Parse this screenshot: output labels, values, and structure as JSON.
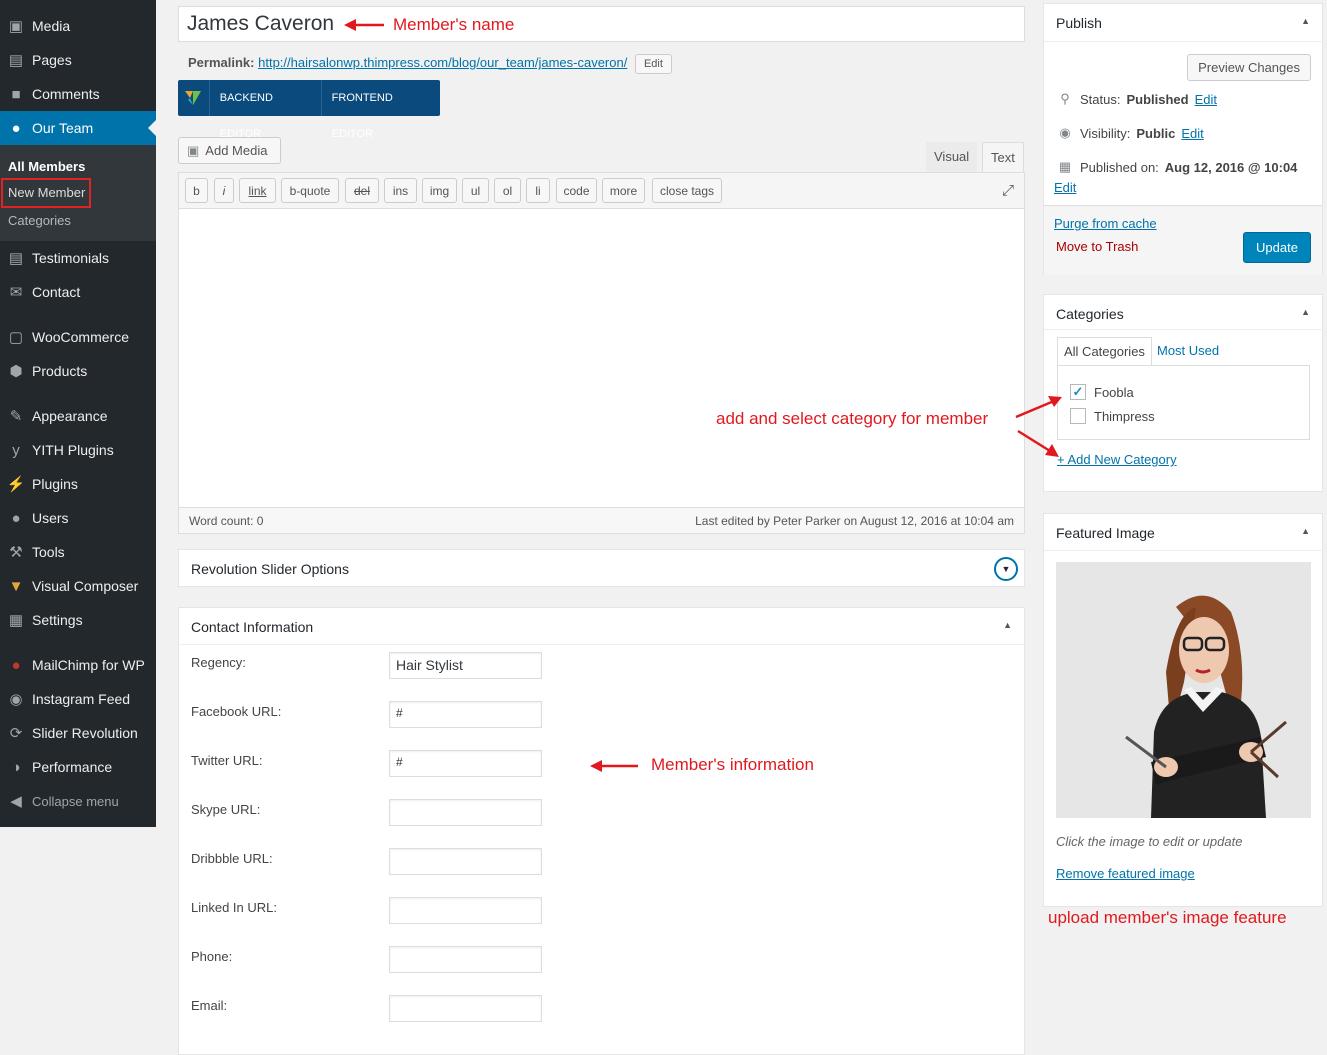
{
  "sidebar": {
    "items": [
      {
        "label": "Media",
        "icon": "media-icon"
      },
      {
        "label": "Pages",
        "icon": "pages-icon"
      },
      {
        "label": "Comments",
        "icon": "comments-icon"
      },
      {
        "label": "Our Team",
        "icon": "team-icon"
      },
      {
        "label": "Testimonials",
        "icon": "testimonials-icon"
      },
      {
        "label": "Contact",
        "icon": "contact-icon"
      },
      {
        "label": "WooCommerce",
        "icon": "woocommerce-icon"
      },
      {
        "label": "Products",
        "icon": "products-icon"
      },
      {
        "label": "Appearance",
        "icon": "appearance-icon"
      },
      {
        "label": "YITH Plugins",
        "icon": "yith-icon"
      },
      {
        "label": "Plugins",
        "icon": "plugins-icon"
      },
      {
        "label": "Users",
        "icon": "users-icon"
      },
      {
        "label": "Tools",
        "icon": "tools-icon"
      },
      {
        "label": "Visual Composer",
        "icon": "visual-composer-icon"
      },
      {
        "label": "Settings",
        "icon": "settings-icon"
      },
      {
        "label": "MailChimp for WP",
        "icon": "mailchimp-icon"
      },
      {
        "label": "Instagram Feed",
        "icon": "instagram-icon"
      },
      {
        "label": "Slider Revolution",
        "icon": "slider-revolution-icon"
      },
      {
        "label": "Performance",
        "icon": "performance-icon"
      }
    ],
    "submenu": [
      "All Members",
      "New Member",
      "Categories"
    ],
    "collapse": "Collapse menu"
  },
  "editor": {
    "title": "James Caveron",
    "permalink_label": "Permalink:",
    "permalink_url": "http://hairsalonwp.thimpress.com/blog/our_team/james-caveron/",
    "edit": "Edit",
    "backend_editor": "BACKEND EDITOR",
    "frontend_editor": "FRONTEND EDITOR",
    "add_media": "Add Media",
    "tab_visual": "Visual",
    "tab_text": "Text",
    "toolbar": [
      "b",
      "i",
      "link",
      "b-quote",
      "del",
      "ins",
      "img",
      "ul",
      "ol",
      "li",
      "code",
      "more",
      "close tags"
    ],
    "word_count": "Word count: 0",
    "last_edited": "Last edited by Peter Parker on August 12, 2016 at 10:04 am"
  },
  "revolution": {
    "title": "Revolution Slider Options"
  },
  "contact": {
    "title": "Contact Information",
    "fields": [
      {
        "label": "Regency:",
        "value": "Hair Stylist"
      },
      {
        "label": "Facebook URL:",
        "value": "#"
      },
      {
        "label": "Twitter URL:",
        "value": "#"
      },
      {
        "label": "Skype URL:",
        "value": ""
      },
      {
        "label": "Dribbble URL:",
        "value": ""
      },
      {
        "label": "Linked In URL:",
        "value": ""
      },
      {
        "label": "Phone:",
        "value": ""
      },
      {
        "label": "Email:",
        "value": ""
      }
    ]
  },
  "publish": {
    "title": "Publish",
    "preview": "Preview Changes",
    "status_label": "Status:",
    "status_value": "Published",
    "visibility_label": "Visibility:",
    "visibility_value": "Public",
    "published_label": "Published on:",
    "published_value": "Aug 12, 2016 @ 10:04",
    "edit": "Edit",
    "purge": "Purge from cache",
    "trash": "Move to Trash",
    "update": "Update"
  },
  "categories": {
    "title": "Categories",
    "tab_all": "All Categories",
    "tab_most": "Most Used",
    "items": [
      {
        "label": "Foobla",
        "checked": true
      },
      {
        "label": "Thimpress",
        "checked": false
      }
    ],
    "add_new": "+ Add New Category"
  },
  "featured": {
    "title": "Featured Image",
    "hint": "Click the image to edit or update",
    "remove": "Remove featured image"
  },
  "annotations": {
    "name": "Member's name",
    "category": "add and select category for member",
    "info": "Member's information",
    "image": "upload member's image feature"
  },
  "colors": {
    "accent": "#0073aa",
    "annotation": "#e1191f",
    "sidebar": "#23282d"
  }
}
